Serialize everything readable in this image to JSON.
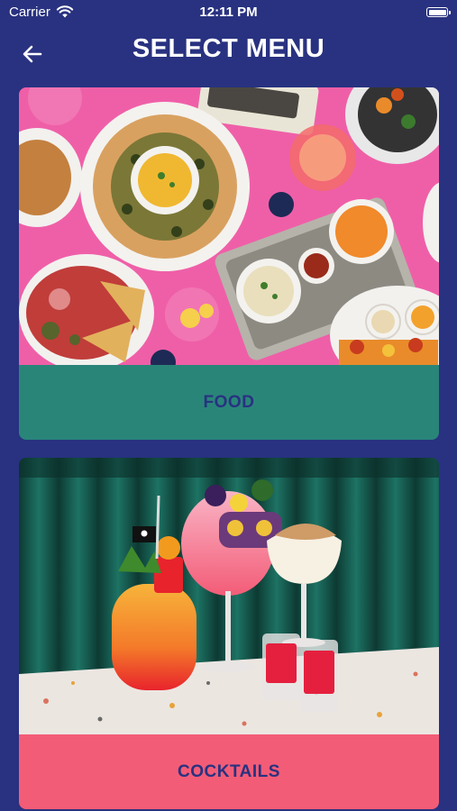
{
  "status": {
    "carrier": "Carrier",
    "time": "12:11 PM"
  },
  "header": {
    "title": "SELECT MENU"
  },
  "menus": [
    {
      "label": "FOOD"
    },
    {
      "label": "COCKTAILS"
    }
  ],
  "colors": {
    "background": "#283280",
    "food_bar": "#2a8579",
    "cocktails_bar": "#f35c77",
    "food_photo_bg": "#ef5fa8"
  },
  "icons": {
    "back": "arrow-left-icon",
    "wifi": "wifi-icon",
    "battery": "battery-icon"
  }
}
